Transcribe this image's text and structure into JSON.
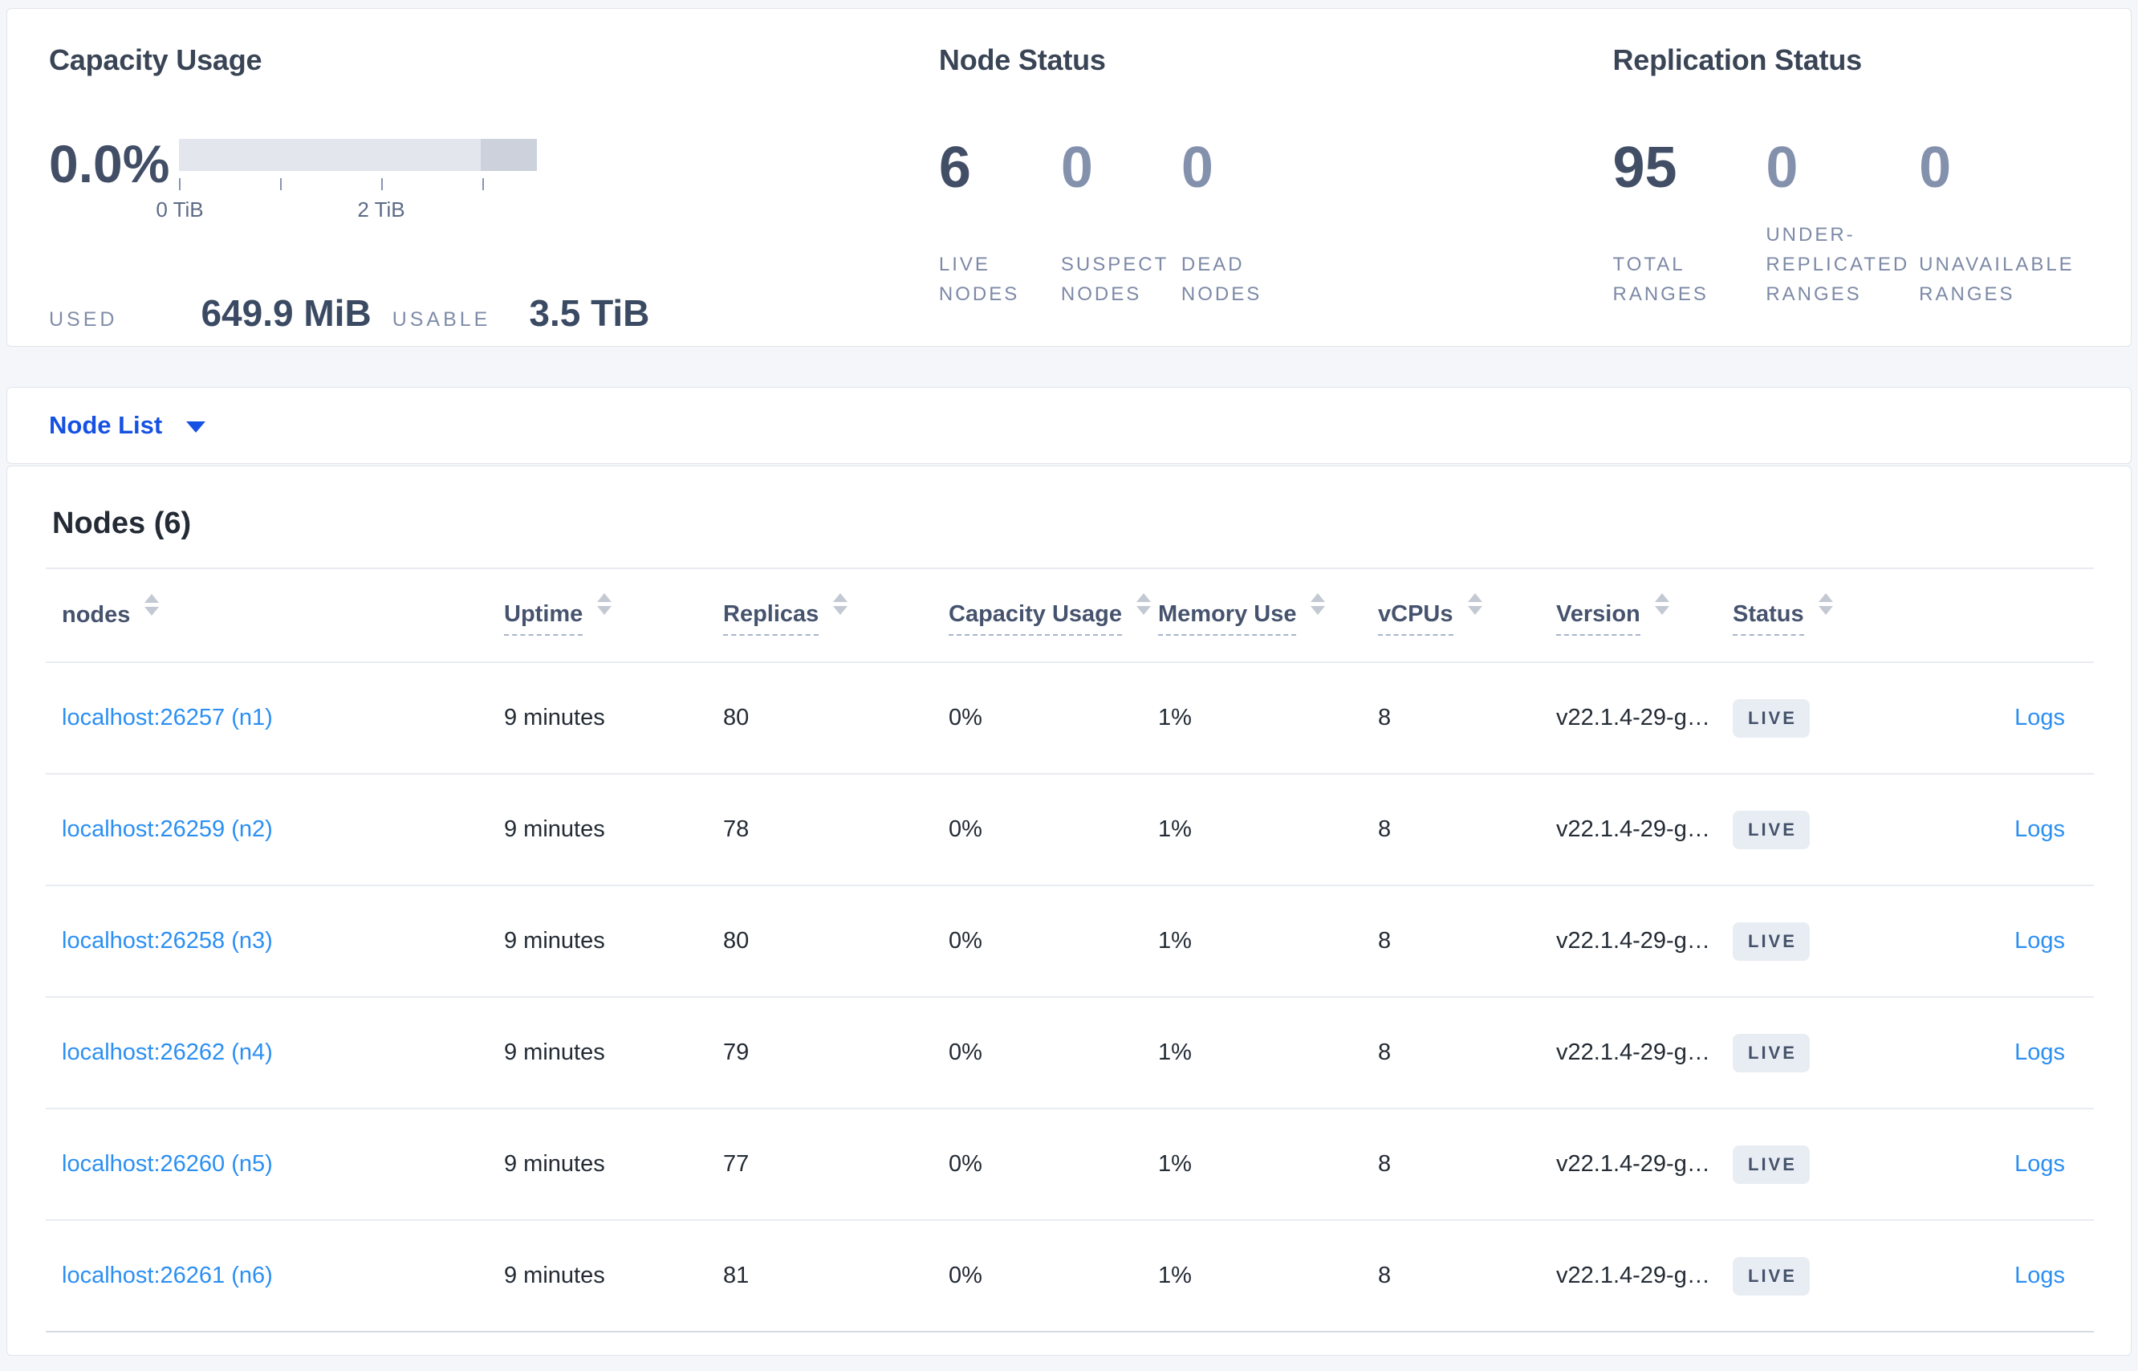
{
  "summary": {
    "capacity": {
      "title": "Capacity Usage",
      "percent": "0.0%",
      "tick_labels": {
        "zero": "0 TiB",
        "two": "2 TiB"
      },
      "used_label": "USED",
      "used_value": "649.9 MiB",
      "usable_label": "USABLE",
      "usable_value": "3.5 TiB"
    },
    "node_status": {
      "title": "Node Status",
      "stats": [
        {
          "value": "6",
          "label": "LIVE NODES"
        },
        {
          "value": "0",
          "label": "SUSPECT NODES"
        },
        {
          "value": "0",
          "label": "DEAD NODES"
        }
      ]
    },
    "replication_status": {
      "title": "Replication Status",
      "stats": [
        {
          "value": "95",
          "label": "TOTAL RANGES"
        },
        {
          "value": "0",
          "label": "UNDER-REPLICATED RANGES"
        },
        {
          "value": "0",
          "label": "UNAVAILABLE RANGES"
        }
      ]
    }
  },
  "selector": {
    "label": "Node List"
  },
  "table": {
    "title": "Nodes (6)",
    "columns": [
      "nodes",
      "Uptime",
      "Replicas",
      "Capacity Usage",
      "Memory Use",
      "vCPUs",
      "Version",
      "Status"
    ],
    "logs_label": "Logs",
    "rows": [
      {
        "node": "localhost:26257 (n1)",
        "uptime": "9 minutes",
        "replicas": "80",
        "capacity": "0%",
        "memory": "1%",
        "vcpus": "8",
        "version": "v22.1.4-29-g…",
        "status": "LIVE"
      },
      {
        "node": "localhost:26259 (n2)",
        "uptime": "9 minutes",
        "replicas": "78",
        "capacity": "0%",
        "memory": "1%",
        "vcpus": "8",
        "version": "v22.1.4-29-g…",
        "status": "LIVE"
      },
      {
        "node": "localhost:26258 (n3)",
        "uptime": "9 minutes",
        "replicas": "80",
        "capacity": "0%",
        "memory": "1%",
        "vcpus": "8",
        "version": "v22.1.4-29-g…",
        "status": "LIVE"
      },
      {
        "node": "localhost:26262 (n4)",
        "uptime": "9 minutes",
        "replicas": "79",
        "capacity": "0%",
        "memory": "1%",
        "vcpus": "8",
        "version": "v22.1.4-29-g…",
        "status": "LIVE"
      },
      {
        "node": "localhost:26260 (n5)",
        "uptime": "9 minutes",
        "replicas": "77",
        "capacity": "0%",
        "memory": "1%",
        "vcpus": "8",
        "version": "v22.1.4-29-g…",
        "status": "LIVE"
      },
      {
        "node": "localhost:26261 (n6)",
        "uptime": "9 minutes",
        "replicas": "81",
        "capacity": "0%",
        "memory": "1%",
        "vcpus": "8",
        "version": "v22.1.4-29-g…",
        "status": "LIVE"
      }
    ]
  },
  "colors": {
    "accent_blue": "#1551e3",
    "link_blue": "#2b8ff2",
    "stat_primary": "#414e66",
    "stat_muted": "#8491ad",
    "label_gray": "#7d89a6",
    "badge_bg": "#e8edf3",
    "bar_light": "#e4e6ed",
    "bar_dark": "#ccd1dc",
    "page_bg": "#f4f6fa"
  }
}
